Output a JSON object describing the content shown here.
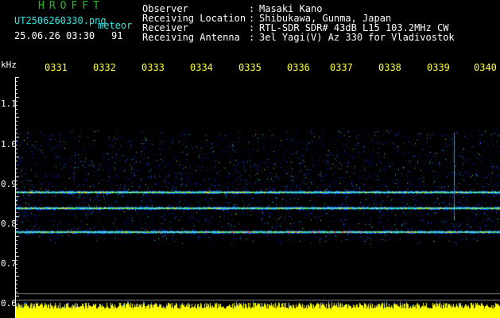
{
  "header": {
    "logo": "HROFFT",
    "filename": "UT2506260330.png",
    "tag": "meteor",
    "date_time": "25.06.26 03:30",
    "count": "91",
    "rows": [
      {
        "label": "Observer",
        "sep": ":",
        "value": "Masaki Kano"
      },
      {
        "label": "Receiving Location",
        "sep": ":",
        "value": "Shibukawa, Gunma, Japan"
      },
      {
        "label": "Receiver",
        "sep": ":",
        "value": "RTL-SDR SDR# 43dB L15 103.2MHz CW"
      },
      {
        "label": "Receiving Antenna",
        "sep": ":",
        "value": "3el Yagi(V) Az 330 for Vladivostok"
      }
    ]
  },
  "axis": {
    "unit": "kHz",
    "time_ticks": [
      "0331",
      "0332",
      "0333",
      "0334",
      "0335",
      "0336",
      "0337",
      "0338",
      "0339",
      "0340"
    ],
    "freq_ticks": [
      "1.1",
      "1.0",
      "0.9",
      "0.8",
      "0.7",
      "0.6"
    ]
  },
  "colors": {
    "background": "#000000",
    "logo": "#19c419",
    "header_text": "#ffffff",
    "filename_text": "#2fe6e6",
    "time_tick": "#ffff33",
    "noise_bar": "#ffff00"
  },
  "spectrogram": {
    "description_hidden": true,
    "carrier_lines_khz": [
      0.88,
      0.84,
      0.78
    ]
  }
}
